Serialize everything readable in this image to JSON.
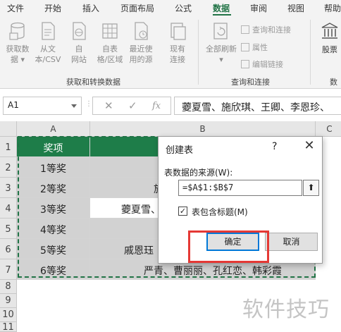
{
  "ribbon_tabs": [
    "文件",
    "开始",
    "插入",
    "页面布局",
    "公式",
    "数据",
    "审阅",
    "视图",
    "帮助"
  ],
  "active_tab": "数据",
  "ribbon": {
    "get_transform": {
      "buttons": [
        {
          "line1": "获取数",
          "line2": "据 ▾"
        },
        {
          "line1": "从文",
          "line2": "本/CSV"
        },
        {
          "line1": "自",
          "line2": "网站"
        },
        {
          "line1": "自表",
          "line2": "格/区域"
        },
        {
          "line1": "最近使",
          "line2": "用的源"
        },
        {
          "line1": "现有",
          "line2": "连接"
        }
      ],
      "group_label": "获取和转换数据"
    },
    "queries": {
      "refresh_line1": "全部刷新",
      "refresh_line2": "▾",
      "small_commands": [
        "查询和连接",
        "属性",
        "编辑链接"
      ],
      "group_label": "查询和连接"
    },
    "stocks": {
      "label": "股票",
      "group_label_partial": "数"
    }
  },
  "formula_bar": {
    "name_box": "A1",
    "fx_cancel": "✕",
    "fx_enter": "✓",
    "fx_label": "fx",
    "value": "蘷夏雪、施欣琪、王卿、李恩珍、"
  },
  "columns": [
    "A",
    "B",
    "C"
  ],
  "rows": [
    {
      "num": "1",
      "a": "奖项",
      "b": ""
    },
    {
      "num": "2",
      "a": "1等奖",
      "b": ""
    },
    {
      "num": "3",
      "a": "2等奖",
      "b": "旅"
    },
    {
      "num": "4",
      "a": "3等奖",
      "b": "蘷夏雪、"
    },
    {
      "num": "5",
      "a": "4等奖",
      "b": ""
    },
    {
      "num": "6",
      "a": "5等奖",
      "b": "　　　戚恩珏"
    },
    {
      "num": "7",
      "a": "6等奖",
      "b": "　　　　　严青、曹丽丽、孔红恋、韩彩霞"
    },
    {
      "num": "8",
      "a": "",
      "b": ""
    },
    {
      "num": "9",
      "a": "",
      "b": ""
    },
    {
      "num": "10",
      "a": "",
      "b": ""
    },
    {
      "num": "11",
      "a": "",
      "b": ""
    }
  ],
  "dialog": {
    "title": "创建表",
    "help": "?",
    "close": "✕",
    "source_label": "表数据的来源(W):",
    "range_value": "=$A$1:$B$7",
    "collapse_glyph": "⬆",
    "checkbox_checked": true,
    "checkbox_mark": "✓",
    "checkbox_label": "表包含标题(M)",
    "ok_label": "确定",
    "cancel_label": "取消"
  },
  "watermark": "软件技巧",
  "colors": {
    "header_green": "#1e7d49",
    "selection_gray": "#d2d2d2",
    "highlight_red": "#e53935",
    "accent_blue": "#0078d7"
  }
}
